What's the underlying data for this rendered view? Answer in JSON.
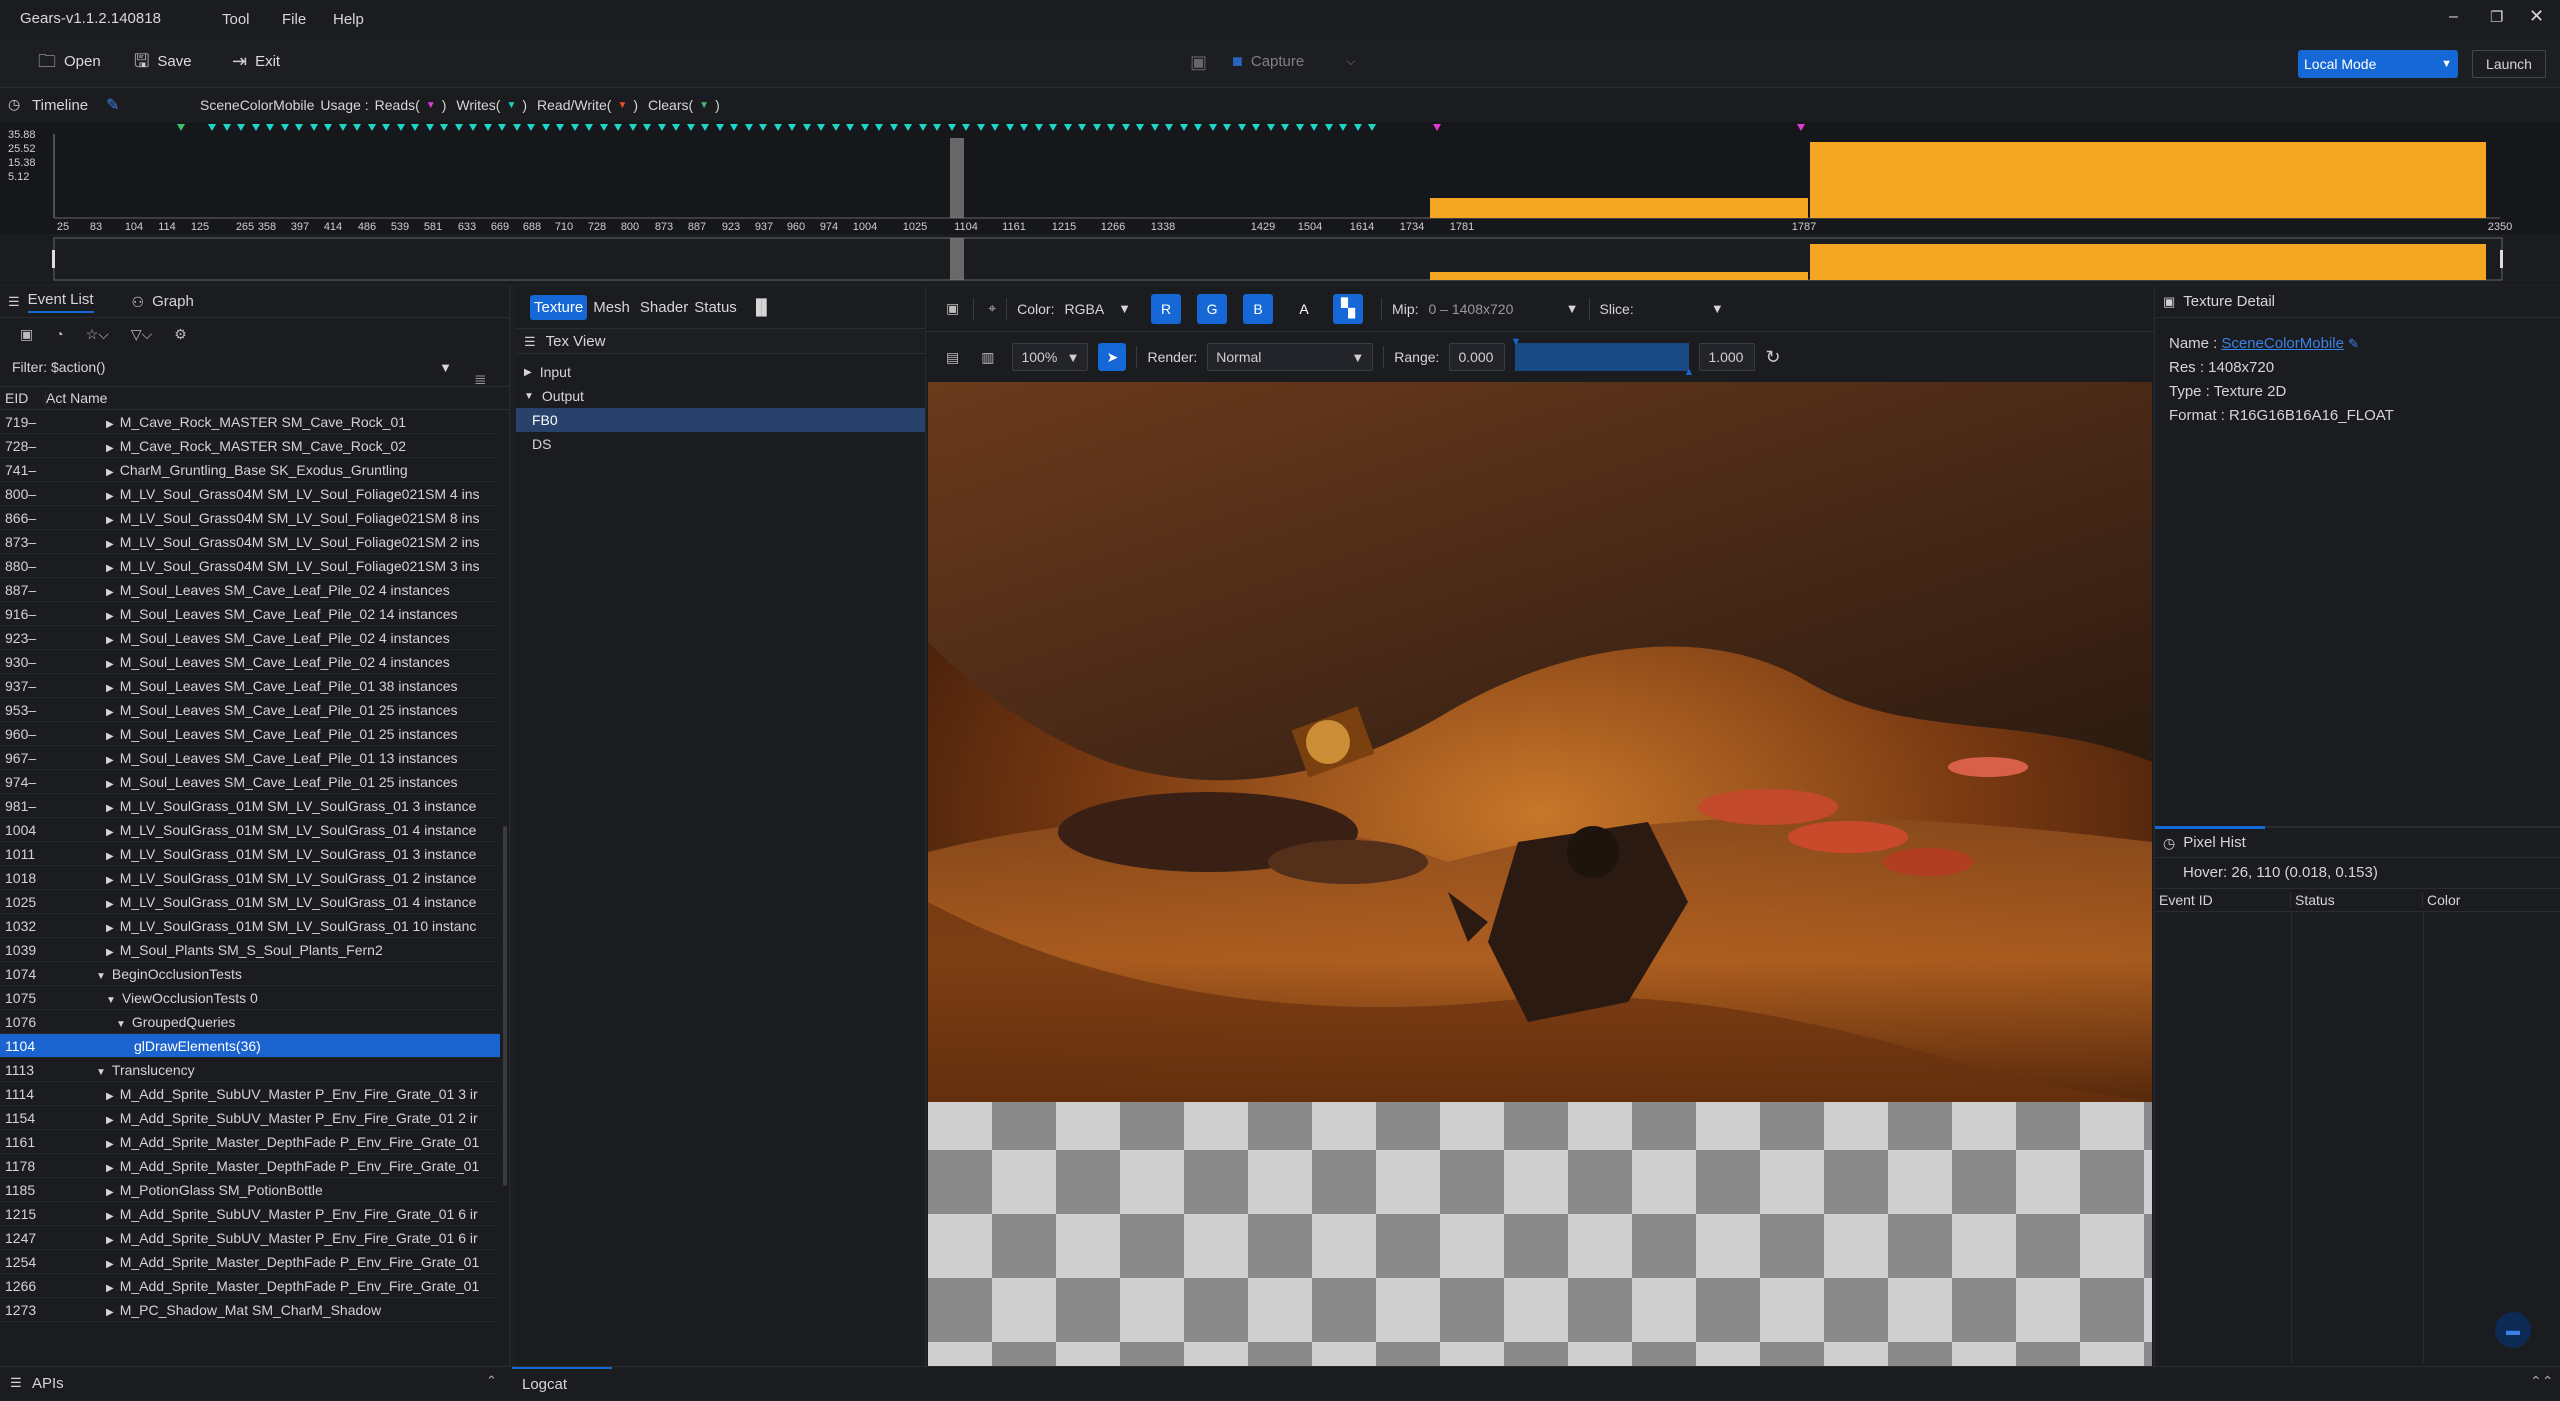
{
  "app": {
    "title": "Gears-v1.1.2.140818"
  },
  "menu": [
    "Tool",
    "File",
    "Help"
  ],
  "toolbar": {
    "open": "Open",
    "save": "Save",
    "exit": "Exit",
    "capture": "Capture",
    "mode": "Local Mode",
    "launch": "Launch"
  },
  "timeline": {
    "tab": "Timeline",
    "usage": {
      "resource": "SceneColorMobile",
      "usage_label": "Usage :",
      "reads": "Reads(",
      "writes": "Writes(",
      "readwrite": "Read/Write(",
      "clears": "Clears(",
      "close": ")"
    },
    "y_ticks": [
      "35.88",
      "25.52",
      "15.38",
      "5.12"
    ],
    "x_ticks": [
      "25",
      "83",
      "104",
      "114",
      "125",
      "265",
      "358",
      "397",
      "414",
      "486",
      "539",
      "581",
      "633",
      "669",
      "688",
      "710",
      "728",
      "800",
      "873",
      "887",
      "923",
      "937",
      "960",
      "974",
      "1004",
      "1025",
      "1104",
      "1161",
      "1215",
      "1266",
      "1338",
      "1429",
      "1504",
      "1614",
      "1734",
      "1781",
      "1787",
      "2350"
    ],
    "colors": {
      "reads": "#1ad6c8",
      "writes": "#3cc06a",
      "readwrite": "#e03ad8",
      "bars": "#f5a623"
    }
  },
  "left": {
    "tabs": [
      "Event List",
      "Graph"
    ],
    "filter_label": "Filter:",
    "filter_value": "$action()",
    "columns": [
      "EID",
      "Act Name"
    ],
    "rows": [
      {
        "eid": "719–",
        "name": "M_Cave_Rock_MASTER SM_Cave_Rock_01",
        "indent": 1,
        "arrow": "▶"
      },
      {
        "eid": "728–",
        "name": "M_Cave_Rock_MASTER SM_Cave_Rock_02",
        "indent": 1,
        "arrow": "▶"
      },
      {
        "eid": "741–",
        "name": "CharM_Gruntling_Base SK_Exodus_Gruntling",
        "indent": 1,
        "arrow": "▶"
      },
      {
        "eid": "800–",
        "name": "M_LV_Soul_Grass04M SM_LV_Soul_Foliage021SM 4 ins",
        "indent": 1,
        "arrow": "▶"
      },
      {
        "eid": "866–",
        "name": "M_LV_Soul_Grass04M SM_LV_Soul_Foliage021SM 8 ins",
        "indent": 1,
        "arrow": "▶"
      },
      {
        "eid": "873–",
        "name": "M_LV_Soul_Grass04M SM_LV_Soul_Foliage021SM 2 ins",
        "indent": 1,
        "arrow": "▶"
      },
      {
        "eid": "880–",
        "name": "M_LV_Soul_Grass04M SM_LV_Soul_Foliage021SM 3 ins",
        "indent": 1,
        "arrow": "▶"
      },
      {
        "eid": "887–",
        "name": "M_Soul_Leaves SM_Cave_Leaf_Pile_02 4 instances",
        "indent": 1,
        "arrow": "▶"
      },
      {
        "eid": "916–",
        "name": "M_Soul_Leaves SM_Cave_Leaf_Pile_02 14 instances",
        "indent": 1,
        "arrow": "▶"
      },
      {
        "eid": "923–",
        "name": "M_Soul_Leaves SM_Cave_Leaf_Pile_02 4 instances",
        "indent": 1,
        "arrow": "▶"
      },
      {
        "eid": "930–",
        "name": "M_Soul_Leaves SM_Cave_Leaf_Pile_02 4 instances",
        "indent": 1,
        "arrow": "▶"
      },
      {
        "eid": "937–",
        "name": "M_Soul_Leaves SM_Cave_Leaf_Pile_01 38 instances",
        "indent": 1,
        "arrow": "▶"
      },
      {
        "eid": "953–",
        "name": "M_Soul_Leaves SM_Cave_Leaf_Pile_01 25 instances",
        "indent": 1,
        "arrow": "▶"
      },
      {
        "eid": "960–",
        "name": "M_Soul_Leaves SM_Cave_Leaf_Pile_01 25 instances",
        "indent": 1,
        "arrow": "▶"
      },
      {
        "eid": "967–",
        "name": "M_Soul_Leaves SM_Cave_Leaf_Pile_01 13 instances",
        "indent": 1,
        "arrow": "▶"
      },
      {
        "eid": "974–",
        "name": "M_Soul_Leaves SM_Cave_Leaf_Pile_01 25 instances",
        "indent": 1,
        "arrow": "▶"
      },
      {
        "eid": "981–",
        "name": "M_LV_SoulGrass_01M SM_LV_SoulGrass_01 3 instance",
        "indent": 1,
        "arrow": "▶"
      },
      {
        "eid": "1004",
        "name": "M_LV_SoulGrass_01M SM_LV_SoulGrass_01 4 instance",
        "indent": 1,
        "arrow": "▶"
      },
      {
        "eid": "1011",
        "name": "M_LV_SoulGrass_01M SM_LV_SoulGrass_01 3 instance",
        "indent": 1,
        "arrow": "▶"
      },
      {
        "eid": "1018",
        "name": "M_LV_SoulGrass_01M SM_LV_SoulGrass_01 2 instance",
        "indent": 1,
        "arrow": "▶"
      },
      {
        "eid": "1025",
        "name": "M_LV_SoulGrass_01M SM_LV_SoulGrass_01 4 instance",
        "indent": 1,
        "arrow": "▶"
      },
      {
        "eid": "1032",
        "name": "M_LV_SoulGrass_01M SM_LV_SoulGrass_01 10 instanc",
        "indent": 1,
        "arrow": "▶"
      },
      {
        "eid": "1039",
        "name": "M_Soul_Plants SM_S_Soul_Plants_Fern2",
        "indent": 1,
        "arrow": "▶"
      },
      {
        "eid": "1074",
        "name": "BeginOcclusionTests",
        "indent": 0,
        "arrow": "▼"
      },
      {
        "eid": "1075",
        "name": "ViewOcclusionTests 0",
        "indent": 1,
        "arrow": "▼"
      },
      {
        "eid": "1076",
        "name": "GroupedQueries",
        "indent": 2,
        "arrow": "▼"
      },
      {
        "eid": "1104",
        "name": "glDrawElements(36)",
        "indent": 3,
        "arrow": "",
        "selected": true
      },
      {
        "eid": "1113",
        "name": "Translucency",
        "indent": 0,
        "arrow": "▼"
      },
      {
        "eid": "1114",
        "name": "M_Add_Sprite_SubUV_Master P_Env_Fire_Grate_01 3 ir",
        "indent": 1,
        "arrow": "▶"
      },
      {
        "eid": "1154",
        "name": "M_Add_Sprite_SubUV_Master P_Env_Fire_Grate_01 2 ir",
        "indent": 1,
        "arrow": "▶"
      },
      {
        "eid": "1161",
        "name": "M_Add_Sprite_Master_DepthFade P_Env_Fire_Grate_01",
        "indent": 1,
        "arrow": "▶"
      },
      {
        "eid": "1178",
        "name": "M_Add_Sprite_Master_DepthFade P_Env_Fire_Grate_01",
        "indent": 1,
        "arrow": "▶"
      },
      {
        "eid": "1185",
        "name": "M_PotionGlass SM_PotionBottle",
        "indent": 1,
        "arrow": "▶"
      },
      {
        "eid": "1215",
        "name": "M_Add_Sprite_SubUV_Master P_Env_Fire_Grate_01 6 ir",
        "indent": 1,
        "arrow": "▶"
      },
      {
        "eid": "1247",
        "name": "M_Add_Sprite_SubUV_Master P_Env_Fire_Grate_01 6 ir",
        "indent": 1,
        "arrow": "▶"
      },
      {
        "eid": "1254",
        "name": "M_Add_Sprite_Master_DepthFade P_Env_Fire_Grate_01",
        "indent": 1,
        "arrow": "▶"
      },
      {
        "eid": "1266",
        "name": "M_Add_Sprite_Master_DepthFade P_Env_Fire_Grate_01",
        "indent": 1,
        "arrow": "▶"
      },
      {
        "eid": "1273",
        "name": "M_PC_Shadow_Mat SM_CharM_Shadow",
        "indent": 1,
        "arrow": "▶"
      }
    ]
  },
  "middle": {
    "tabs": [
      "Texture",
      "Mesh",
      "Shader",
      "Status"
    ],
    "section": "Tex View",
    "tree": [
      {
        "label": "Input",
        "arrow": "▶",
        "indent": 0
      },
      {
        "label": "Output",
        "arrow": "▼",
        "indent": 0
      },
      {
        "label": "FB0",
        "arrow": "",
        "indent": 1,
        "selected": true
      },
      {
        "label": "DS",
        "arrow": "",
        "indent": 1
      }
    ]
  },
  "viewer": {
    "color_label": "Color:",
    "color_value": "RGBA",
    "channels": [
      "R",
      "G",
      "B",
      "A"
    ],
    "mip_label": "Mip:",
    "mip_value": "0 – 1408x720",
    "slice_label": "Slice:",
    "zoom": "100%",
    "render_label": "Render:",
    "render_value": "Normal",
    "range_label": "Range:",
    "range_min": "0.000",
    "range_max": "1.000"
  },
  "right": {
    "detail_title": "Texture Detail",
    "name_label": "Name :",
    "name_value": "SceneColorMobile",
    "res": "Res : 1408x720",
    "type": "Type : Texture 2D",
    "format": "Format : R16G16B16A16_FLOAT",
    "pixel_title": "Pixel Hist",
    "hover": "Hover: 26, 110 (0.018, 0.153)",
    "columns": [
      "Event ID",
      "Status",
      "Color"
    ]
  },
  "bottom": {
    "apis": "APIs",
    "logcat": "Logcat"
  }
}
